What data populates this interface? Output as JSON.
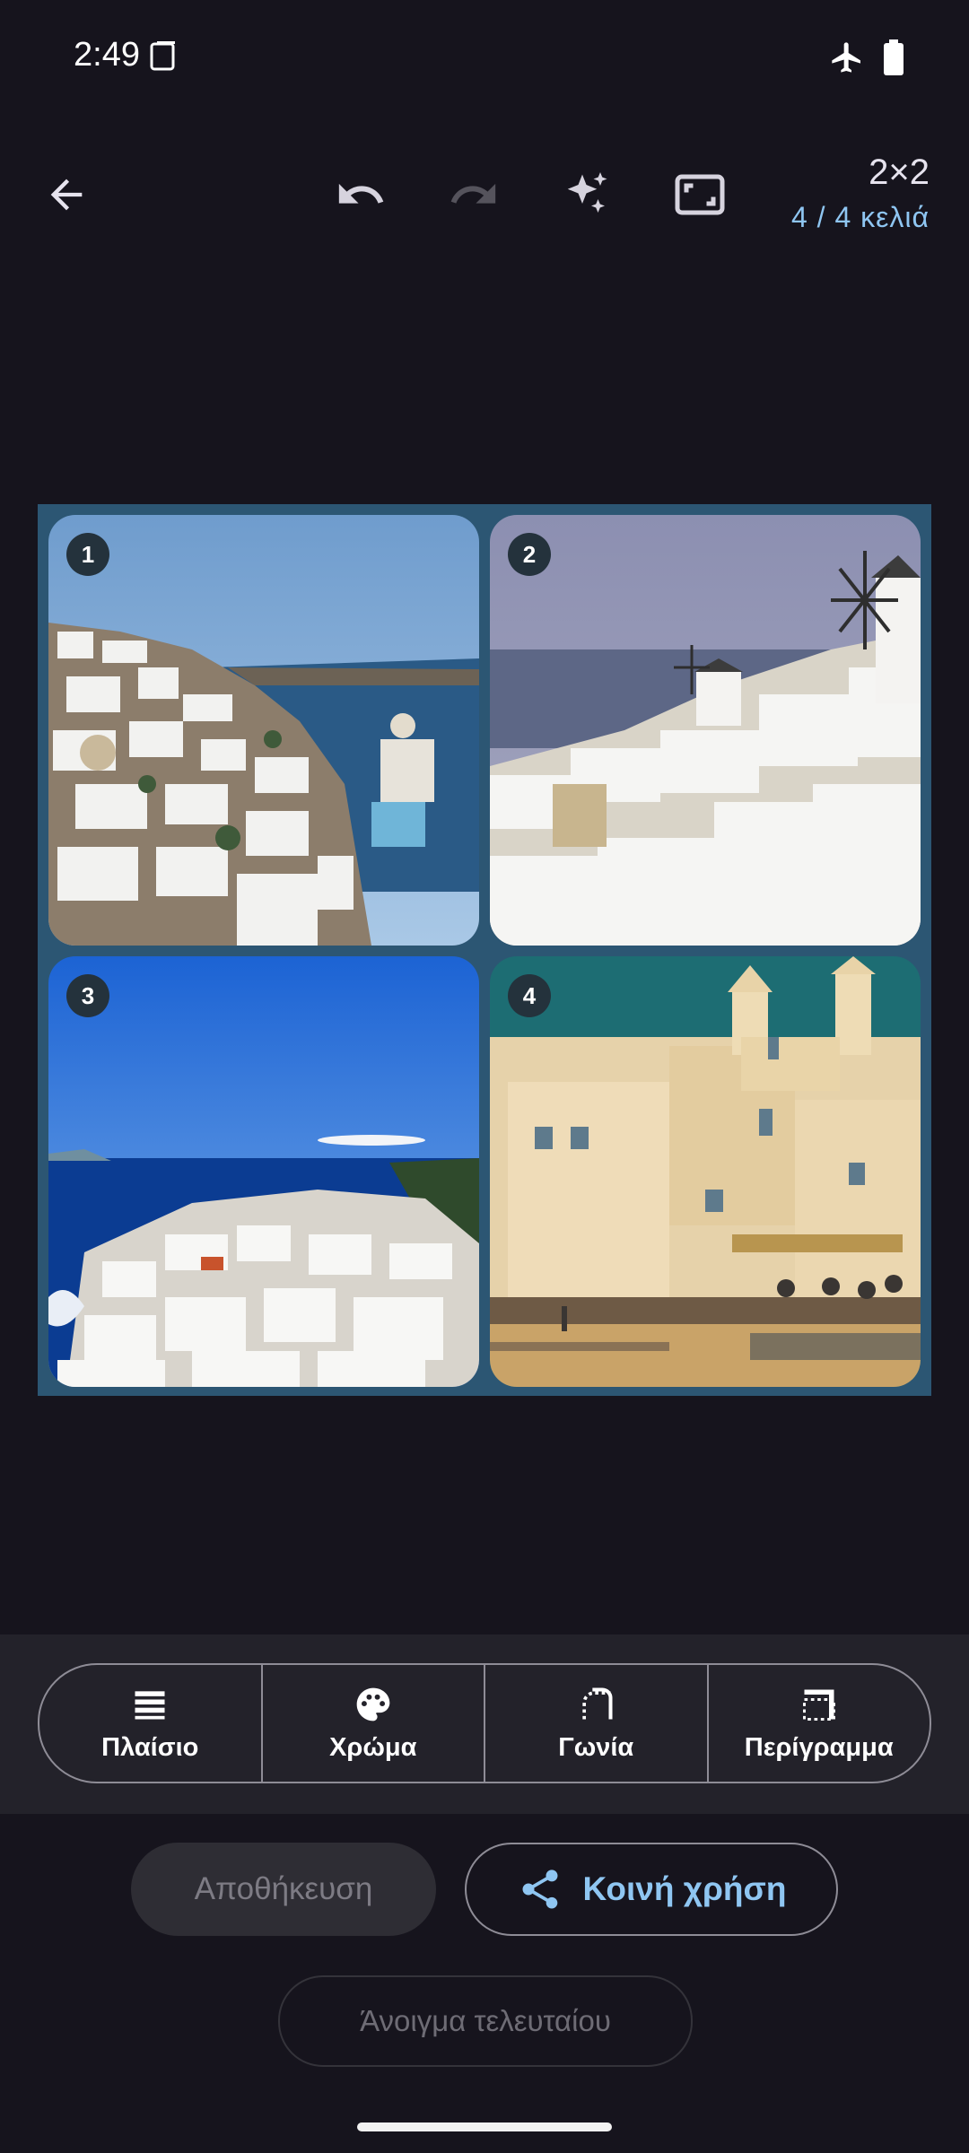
{
  "status_bar": {
    "time": "2:49",
    "icons": [
      "sim-card-icon",
      "airplane-mode-icon",
      "battery-icon"
    ]
  },
  "toolbar": {
    "icons": [
      "back-arrow-icon",
      "undo-icon",
      "redo-icon",
      "sparkle-icon",
      "fullscreen-icon"
    ],
    "grid_size": "2×2",
    "cell_count": "4 / 4 κελιά"
  },
  "collage": {
    "frame_color": "#2c5673",
    "cells": [
      {
        "number": "1",
        "subject": "white cliffside village above the sea"
      },
      {
        "number": "2",
        "subject": "white village with windmills"
      },
      {
        "number": "3",
        "subject": "white town on the coast under a blue sky"
      },
      {
        "number": "4",
        "subject": "cream buildings and church by a beach"
      }
    ]
  },
  "tools": [
    {
      "label": "Πλαίσιο",
      "icon": "frame-lines-icon"
    },
    {
      "label": "Χρώμα",
      "icon": "palette-icon"
    },
    {
      "label": "Γωνία",
      "icon": "rounded-corner-icon"
    },
    {
      "label": "Περίγραμμα",
      "icon": "border-icon"
    }
  ],
  "actions": {
    "save": "Αποθήκευση",
    "share": "Κοινή χρήση",
    "open_last": "Άνοιγμα τελευταίου"
  },
  "colors": {
    "accent": "#8fc6f2",
    "background": "#16141d",
    "panel": "#23222a"
  }
}
